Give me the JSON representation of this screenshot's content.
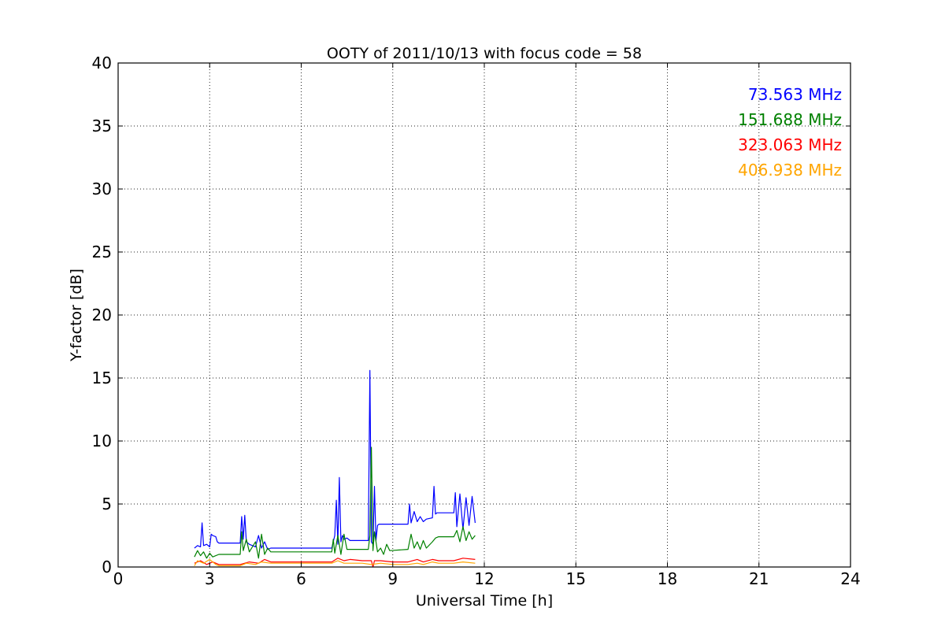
{
  "chart_data": {
    "type": "line",
    "title": "OOTY of 2011/10/13 with focus code = 58",
    "xlabel": "Universal Time [h]",
    "ylabel": "Y-factor [dB]",
    "xlim": [
      0,
      24
    ],
    "ylim": [
      0,
      40
    ],
    "xticks": [
      0,
      3,
      6,
      9,
      12,
      15,
      18,
      21,
      24
    ],
    "yticks": [
      0,
      5,
      10,
      15,
      20,
      25,
      30,
      35,
      40
    ],
    "grid": true,
    "legend_placement": "top-right",
    "series": [
      {
        "name": "73.563 MHz",
        "color": "#0000ff",
        "x": [
          2.5,
          2.6,
          2.7,
          2.75,
          2.8,
          2.9,
          3.0,
          3.05,
          3.1,
          3.2,
          3.25,
          3.3,
          4.0,
          4.05,
          4.1,
          4.15,
          4.2,
          4.3,
          4.5,
          4.6,
          4.7,
          4.8,
          4.9,
          5.0,
          7.0,
          7.1,
          7.15,
          7.2,
          7.25,
          7.3,
          7.35,
          7.4,
          7.5,
          7.6,
          8.0,
          8.2,
          8.25,
          8.3,
          8.35,
          8.4,
          8.45,
          8.5,
          8.55,
          8.6,
          9.5,
          9.55,
          9.6,
          9.7,
          9.8,
          9.9,
          10.0,
          10.1,
          10.3,
          10.35,
          10.4,
          10.45,
          10.5,
          11.0,
          11.05,
          11.1,
          11.2,
          11.3,
          11.4,
          11.5,
          11.6,
          11.7
        ],
        "y": [
          1.5,
          1.7,
          1.6,
          3.5,
          1.7,
          1.8,
          1.6,
          2.6,
          2.5,
          2.4,
          2.0,
          1.9,
          1.9,
          4.0,
          2.2,
          4.1,
          2.0,
          1.8,
          1.6,
          2.5,
          1.5,
          2.0,
          1.4,
          1.5,
          1.5,
          2.5,
          5.3,
          1.8,
          7.1,
          2.0,
          2.5,
          2.2,
          2.3,
          2.1,
          2.1,
          2.1,
          15.6,
          2.0,
          1.8,
          6.4,
          2.1,
          3.3,
          3.4,
          3.4,
          3.4,
          5.0,
          3.5,
          4.4,
          3.6,
          4.0,
          3.6,
          3.8,
          3.9,
          6.4,
          4.2,
          4.3,
          4.3,
          4.3,
          5.9,
          3.2,
          5.8,
          3.0,
          5.5,
          3.3,
          5.6,
          3.5
        ]
      },
      {
        "name": "151.688 MHz",
        "color": "#008000",
        "x": [
          2.5,
          2.6,
          2.7,
          2.8,
          2.9,
          3.0,
          3.1,
          3.3,
          4.0,
          4.05,
          4.1,
          4.2,
          4.3,
          4.5,
          4.6,
          4.7,
          4.8,
          4.9,
          5.0,
          7.0,
          7.05,
          7.1,
          7.2,
          7.3,
          7.4,
          7.5,
          8.2,
          8.25,
          8.3,
          8.35,
          8.4,
          8.5,
          8.6,
          8.7,
          8.8,
          8.9,
          9.5,
          9.6,
          9.7,
          9.8,
          9.9,
          10.0,
          10.1,
          10.3,
          10.4,
          10.5,
          11.0,
          11.1,
          11.2,
          11.3,
          11.4,
          11.5,
          11.6,
          11.7
        ],
        "y": [
          0.8,
          1.3,
          0.9,
          1.2,
          0.7,
          1.1,
          0.8,
          1.0,
          1.0,
          2.8,
          1.3,
          2.2,
          1.2,
          2.0,
          0.7,
          2.6,
          1.0,
          1.5,
          1.2,
          1.2,
          2.2,
          1.1,
          2.5,
          1.0,
          2.6,
          1.4,
          1.4,
          2.5,
          9.5,
          1.3,
          2.8,
          1.2,
          1.5,
          1.0,
          1.8,
          1.3,
          1.4,
          2.6,
          1.5,
          2.0,
          1.4,
          2.1,
          1.5,
          2.0,
          2.3,
          2.4,
          2.4,
          2.9,
          2.0,
          3.2,
          2.1,
          2.8,
          2.2,
          2.5
        ]
      },
      {
        "name": "323.063 MHz",
        "color": "#ff0000",
        "x": [
          2.5,
          2.7,
          2.9,
          3.1,
          3.3,
          4.0,
          4.3,
          4.6,
          4.8,
          5.0,
          7.0,
          7.2,
          7.4,
          7.6,
          8.0,
          8.3,
          8.35,
          8.4,
          8.6,
          9.0,
          9.5,
          9.8,
          10.0,
          10.3,
          10.5,
          11.0,
          11.3,
          11.7
        ],
        "y": [
          0.3,
          0.5,
          0.2,
          0.4,
          0.2,
          0.2,
          0.4,
          0.3,
          0.6,
          0.4,
          0.4,
          0.7,
          0.5,
          0.6,
          0.5,
          0.5,
          0.0,
          0.5,
          0.5,
          0.4,
          0.4,
          0.6,
          0.4,
          0.6,
          0.5,
          0.5,
          0.7,
          0.6
        ]
      },
      {
        "name": "406.938 MHz",
        "color": "#ffa500",
        "x": [
          2.5,
          2.6,
          2.8,
          3.0,
          3.2,
          3.3,
          4.0,
          4.2,
          4.5,
          4.7,
          5.0,
          7.0,
          7.2,
          7.4,
          8.0,
          8.3,
          8.6,
          9.0,
          9.5,
          9.8,
          10.0,
          10.3,
          10.5,
          11.0,
          11.3,
          11.7
        ],
        "y": [
          0.1,
          0.5,
          0.3,
          0.6,
          0.2,
          0.1,
          0.1,
          0.3,
          0.2,
          0.4,
          0.3,
          0.3,
          0.5,
          0.3,
          0.3,
          0.2,
          0.3,
          0.2,
          0.2,
          0.3,
          0.2,
          0.4,
          0.3,
          0.3,
          0.4,
          0.3
        ]
      }
    ]
  }
}
